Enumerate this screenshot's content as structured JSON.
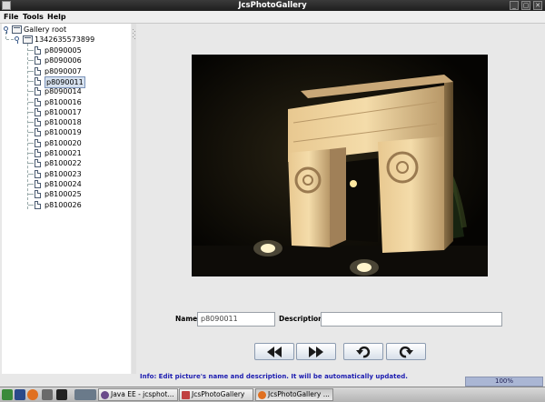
{
  "window": {
    "title": "JcsPhotoGallery"
  },
  "menu": [
    "File",
    "Tools",
    "Help"
  ],
  "tree": {
    "root": "Gallery root",
    "album": "1342635573899",
    "items": [
      "p8090005",
      "p8090006",
      "p8090007",
      "p8090011",
      "p8090014",
      "p8100016",
      "p8100017",
      "p8100018",
      "p8100019",
      "p8100020",
      "p8100021",
      "p8100022",
      "p8100023",
      "p8100024",
      "p8100025",
      "p8100026"
    ],
    "selected_index": 3
  },
  "form": {
    "name_label": "Name:",
    "name_value": "p8090011",
    "description_label": "Description:",
    "description_value": ""
  },
  "toolbar": {
    "previous_icon": "double-left-arrow-icon",
    "next_icon": "double-right-arrow-icon",
    "rotate_left_icon": "rotate-left-icon",
    "rotate_right_icon": "rotate-right-icon"
  },
  "status": {
    "info": "Info: Edit picture's name and description. It will be automatically updated.",
    "progress_label": "100%",
    "progress_fraction": 1.0
  },
  "taskbar": {
    "tasks": [
      "Java EE - jcsphot...",
      "JcsPhotoGallery",
      "JcsPhotoGallery ..."
    ],
    "active_index": 2
  },
  "colors": {
    "info_text": "#1c1cb0",
    "title_bar": "#2a2a2a",
    "selection": "#d6e1ef"
  }
}
